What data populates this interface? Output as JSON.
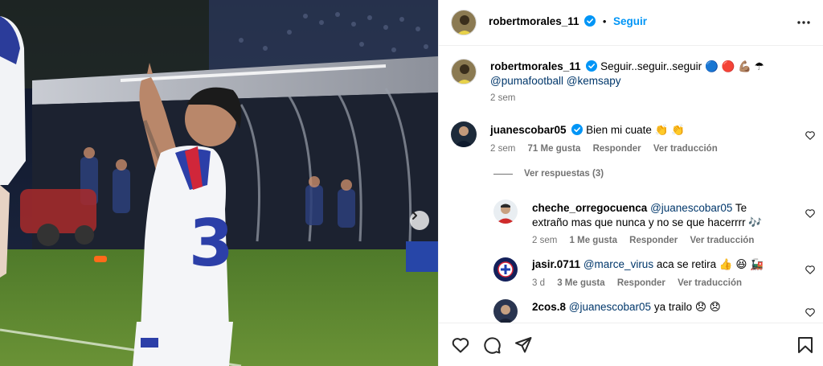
{
  "post": {
    "author": "robertmorales_11",
    "follow_label": "Seguir",
    "dot": "•"
  },
  "caption": {
    "author": "robertmorales_11",
    "text": "Seguir..seguir..seguir",
    "emojis": "🔵 🔴 💪🏽 ☂",
    "mentions": "@pumafootball @kemsapy",
    "time": "2 sem"
  },
  "comments": [
    {
      "author": "juanescobar05",
      "verified": true,
      "mention": "",
      "text": "Bien mi cuate 👏 👏",
      "time": "2 sem",
      "likes": "71 Me gusta",
      "reply": "Responder",
      "translate": "Ver traducción"
    },
    {
      "author": "cheche_orregocuenca",
      "verified": false,
      "mention": "@juanescobar05",
      "text": " Te extraño mas que nunca y no se que hacerrrr 🎶",
      "time": "2 sem",
      "likes": "1 Me gusta",
      "reply": "Responder",
      "translate": "Ver traducción"
    },
    {
      "author": "jasir.0711",
      "verified": false,
      "mention": "@marce_virus",
      "text": " aca se retira 👍 😆 🚂",
      "time": "3 d",
      "likes": "3 Me gusta",
      "reply": "Responder",
      "translate": "Ver traducción"
    },
    {
      "author": "2cos.8",
      "verified": false,
      "mention": "@juanescobar05",
      "text": " ya trailo 😞 😞",
      "time": "",
      "likes": "",
      "reply": "",
      "translate": ""
    }
  ],
  "view_replies": "Ver respuestas (3)",
  "colors": {
    "accent": "#0095f6",
    "mention": "#00376b",
    "meta": "#737373",
    "verified": "#0095f6"
  },
  "icons": [
    "more-options-icon",
    "next-image-icon",
    "heart-icon",
    "comment-icon",
    "share-icon",
    "bookmark-icon",
    "verified-badge-icon"
  ]
}
